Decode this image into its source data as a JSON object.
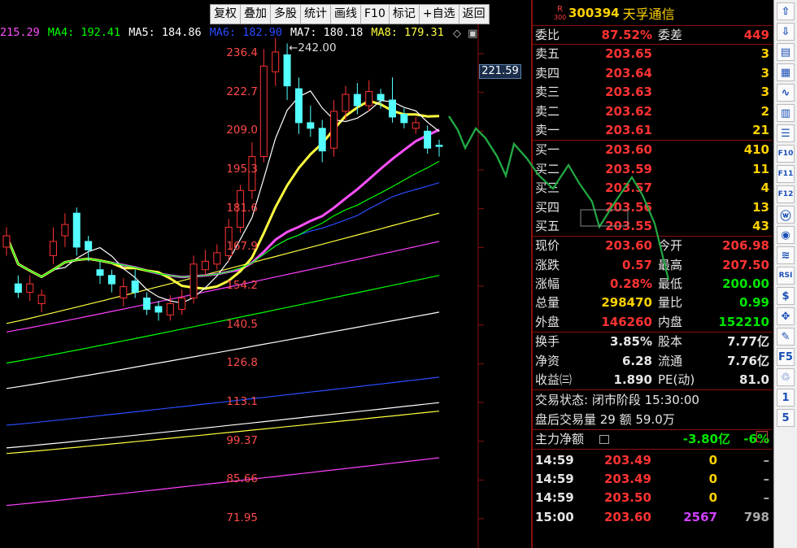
{
  "toolbar": {
    "items": [
      "复权",
      "叠加",
      "多股",
      "统计",
      "画线",
      "F10",
      "标记",
      "+自选",
      "返回"
    ]
  },
  "ma_legend": [
    {
      "label": "215.29",
      "color": "#ff50ff"
    },
    {
      "label": "MA4: 192.41",
      "color": "#00ff00"
    },
    {
      "label": "MA5: 184.86",
      "color": "#ffffff"
    },
    {
      "label": "MA6: 182.90",
      "color": "#2a4cff"
    },
    {
      "label": "MA7: 180.18",
      "color": "#ffffff"
    },
    {
      "label": "MA8: 179.31",
      "color": "#ffff40"
    },
    {
      "label": "MA",
      "color": "#ff50ff"
    }
  ],
  "chart_controls": [
    "◇",
    "▣"
  ],
  "peak_label": "242.00",
  "current_price_tag": "221.59",
  "chart_data": {
    "type": "candlestick",
    "y_ticks": [
      "236.4",
      "222.7",
      "209.0",
      "195.3",
      "181.6",
      "167.9",
      "154.2",
      "140.5",
      "126.8",
      "113.1",
      "99.37",
      "85.66",
      "71.95"
    ],
    "ylim": [
      71.95,
      236.4
    ],
    "candles": [
      {
        "o": 168,
        "c": 172,
        "h": 175,
        "l": 165
      },
      {
        "o": 155,
        "c": 152,
        "h": 158,
        "l": 150
      },
      {
        "o": 152,
        "c": 155,
        "h": 158,
        "l": 149
      },
      {
        "o": 148,
        "c": 151,
        "h": 153,
        "l": 145
      },
      {
        "o": 165,
        "c": 170,
        "h": 175,
        "l": 162
      },
      {
        "o": 172,
        "c": 176,
        "h": 180,
        "l": 168
      },
      {
        "o": 180,
        "c": 168,
        "h": 182,
        "l": 165
      },
      {
        "o": 170,
        "c": 167,
        "h": 172,
        "l": 163
      },
      {
        "o": 160,
        "c": 158,
        "h": 163,
        "l": 155
      },
      {
        "o": 158,
        "c": 155,
        "h": 160,
        "l": 152
      },
      {
        "o": 150,
        "c": 154,
        "h": 157,
        "l": 147
      },
      {
        "o": 156,
        "c": 152,
        "h": 160,
        "l": 150
      },
      {
        "o": 150,
        "c": 146,
        "h": 152,
        "l": 144
      },
      {
        "o": 147,
        "c": 145,
        "h": 149,
        "l": 142
      },
      {
        "o": 144,
        "c": 148,
        "h": 151,
        "l": 142
      },
      {
        "o": 146,
        "c": 150,
        "h": 153,
        "l": 144
      },
      {
        "o": 150,
        "c": 162,
        "h": 165,
        "l": 148
      },
      {
        "o": 160,
        "c": 163,
        "h": 167,
        "l": 158
      },
      {
        "o": 162,
        "c": 166,
        "h": 169,
        "l": 160
      },
      {
        "o": 165,
        "c": 175,
        "h": 178,
        "l": 163
      },
      {
        "o": 175,
        "c": 188,
        "h": 190,
        "l": 173
      },
      {
        "o": 188,
        "c": 200,
        "h": 205,
        "l": 185
      },
      {
        "o": 200,
        "c": 232,
        "h": 238,
        "l": 198
      },
      {
        "o": 230,
        "c": 237,
        "h": 242,
        "l": 225
      },
      {
        "o": 236,
        "c": 225,
        "h": 240,
        "l": 220
      },
      {
        "o": 224,
        "c": 212,
        "h": 228,
        "l": 208
      },
      {
        "o": 212,
        "c": 210,
        "h": 218,
        "l": 207
      },
      {
        "o": 210,
        "c": 202,
        "h": 213,
        "l": 198
      },
      {
        "o": 203,
        "c": 216,
        "h": 220,
        "l": 200
      },
      {
        "o": 216,
        "c": 222,
        "h": 225,
        "l": 213
      },
      {
        "o": 222,
        "c": 218,
        "h": 226,
        "l": 215
      },
      {
        "o": 218,
        "c": 223,
        "h": 227,
        "l": 216
      },
      {
        "o": 222,
        "c": 220,
        "h": 224,
        "l": 217
      },
      {
        "o": 220,
        "c": 214,
        "h": 228,
        "l": 212
      },
      {
        "o": 215,
        "c": 212,
        "h": 217,
        "l": 210
      },
      {
        "o": 210,
        "c": 212,
        "h": 214,
        "l": 208
      },
      {
        "o": 209,
        "c": 203,
        "h": 211,
        "l": 201
      },
      {
        "o": 204,
        "c": 203.6,
        "h": 206,
        "l": 200
      }
    ]
  },
  "stock": {
    "code": "300394",
    "name": "天孚通信",
    "badge_top": "R",
    "badge_bottom": "300"
  },
  "ratio": {
    "label1": "委比",
    "value1": "87.52%",
    "label2": "委差",
    "value2": "449"
  },
  "sells": [
    {
      "label": "卖五",
      "price": "203.65",
      "vol": "3"
    },
    {
      "label": "卖四",
      "price": "203.64",
      "vol": "3"
    },
    {
      "label": "卖三",
      "price": "203.63",
      "vol": "3"
    },
    {
      "label": "卖二",
      "price": "203.62",
      "vol": "2"
    },
    {
      "label": "卖一",
      "price": "203.61",
      "vol": "21"
    }
  ],
  "buys": [
    {
      "label": "买一",
      "price": "203.60",
      "vol": "410"
    },
    {
      "label": "买二",
      "price": "203.59",
      "vol": "11"
    },
    {
      "label": "买三",
      "price": "203.57",
      "vol": "4"
    },
    {
      "label": "买四",
      "price": "203.56",
      "vol": "13"
    },
    {
      "label": "买五",
      "price": "203.55",
      "vol": "43"
    }
  ],
  "quote": [
    {
      "l1": "现价",
      "v1": "203.60",
      "c1": "red",
      "l2": "今开",
      "v2": "206.98",
      "c2": "red"
    },
    {
      "l1": "涨跌",
      "v1": "0.57",
      "c1": "red",
      "l2": "最高",
      "v2": "207.50",
      "c2": "red"
    },
    {
      "l1": "涨幅",
      "v1": "0.28%",
      "c1": "red",
      "l2": "最低",
      "v2": "200.00",
      "c2": "green"
    },
    {
      "l1": "总量",
      "v1": "298470",
      "c1": "yellow",
      "l2": "量比",
      "v2": "0.99",
      "c2": "green"
    },
    {
      "l1": "外盘",
      "v1": "146260",
      "c1": "red",
      "l2": "内盘",
      "v2": "152210",
      "c2": "green"
    }
  ],
  "fund": [
    {
      "l1": "换手",
      "v1": "3.85%",
      "l2": "股本",
      "v2": "7.77亿"
    },
    {
      "l1": "净资",
      "v1": "6.28",
      "l2": "流通",
      "v2": "7.76亿"
    },
    {
      "l1": "收益㈢",
      "v1": "1.890",
      "l2": "PE(动)",
      "v2": "81.0"
    }
  ],
  "status": {
    "line1": "交易状态: 闭市阶段 15:30:00",
    "line2": "盘后交易量 29 额 59.0万"
  },
  "main_net": {
    "label": "主力净额",
    "value": "-3.80亿",
    "pct": "-6%"
  },
  "trades": [
    {
      "time": "14:59",
      "price": "203.49",
      "vol": "0",
      "dir": "–"
    },
    {
      "time": "14:59",
      "price": "203.49",
      "vol": "0",
      "dir": "–"
    },
    {
      "time": "14:59",
      "price": "203.50",
      "vol": "0",
      "dir": "–"
    },
    {
      "time": "15:00",
      "price": "203.60",
      "vol": "2567",
      "dir": "798"
    }
  ],
  "right_tools": [
    "⇧",
    "⇩",
    "▤",
    "▦",
    "∿",
    "▥",
    "☰",
    "F10",
    "F11",
    "F12",
    "ⓦ",
    "◉",
    "≋",
    "RSI",
    "$",
    "✥",
    "✎",
    "F5",
    "♲",
    "1",
    "5"
  ]
}
